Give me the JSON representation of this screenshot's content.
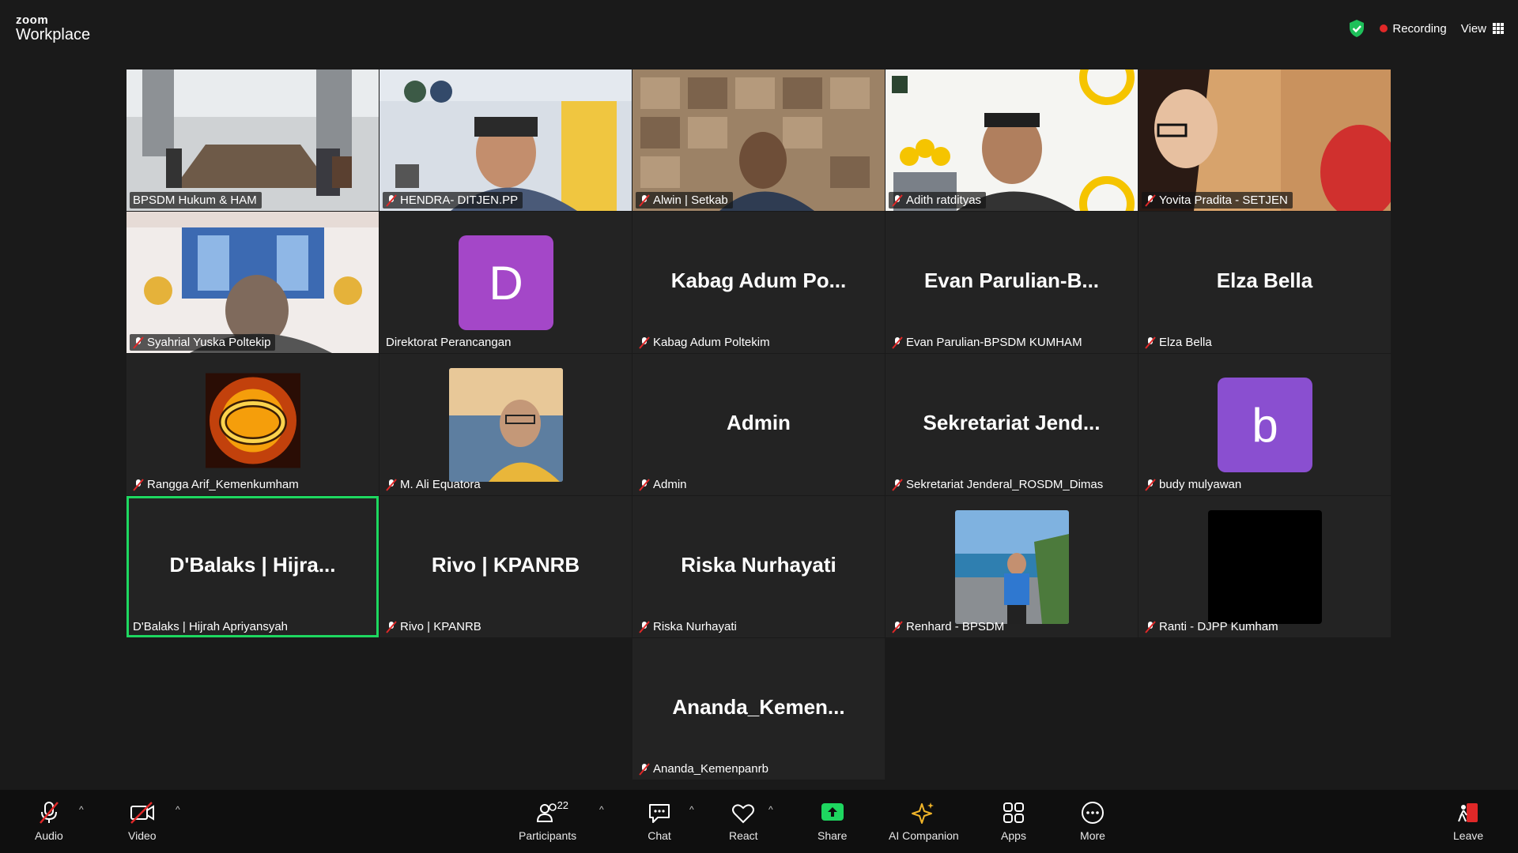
{
  "app": {
    "brand_small": "zoom",
    "brand_large": "Workplace"
  },
  "top": {
    "recording_label": "Recording",
    "view_label": "View"
  },
  "colors": {
    "active_border": "#1ed760",
    "avatar_purple": "#a447c8",
    "recording_dot": "#e02828",
    "share_green": "#1ed760"
  },
  "tiles": [
    {
      "name": "BPSDM Hukum & HAM",
      "muted": false,
      "kind": "video"
    },
    {
      "name": "HENDRA- DITJEN.PP",
      "muted": true,
      "kind": "video"
    },
    {
      "name": "Alwin | Setkab",
      "muted": true,
      "kind": "video"
    },
    {
      "name": "Adith ratdityas",
      "muted": true,
      "kind": "video"
    },
    {
      "name": "Yovita Pradita - SETJEN",
      "muted": true,
      "kind": "video"
    },
    {
      "name": "Syahrial Yuska Poltekip",
      "muted": true,
      "kind": "video"
    },
    {
      "name": "Direktorat Perancangan",
      "muted": false,
      "kind": "avatar",
      "avatar": "D"
    },
    {
      "name": "Kabag Adum Poltekim",
      "muted": true,
      "kind": "text",
      "big": "Kabag  Adum  Po..."
    },
    {
      "name": "Evan Parulian-BPSDM KUMHAM",
      "muted": true,
      "kind": "text",
      "big": "Evan  Parulian-B..."
    },
    {
      "name": "Elza Bella",
      "muted": true,
      "kind": "text",
      "big": "Elza Bella"
    },
    {
      "name": "Rangga Arif_Kemenkumham",
      "muted": true,
      "kind": "photo"
    },
    {
      "name": "M. Ali Equatora",
      "muted": true,
      "kind": "photo"
    },
    {
      "name": "Admin",
      "muted": true,
      "kind": "text",
      "big": "Admin"
    },
    {
      "name": "Sekretariat Jenderal_ROSDM_Dimas",
      "muted": true,
      "kind": "text",
      "big": "Sekretariat  Jend..."
    },
    {
      "name": "budy mulyawan",
      "muted": true,
      "kind": "avatar",
      "avatar": "b"
    },
    {
      "name": "D'Balaks | Hijrah Apriyansyah",
      "muted": false,
      "kind": "text",
      "big": "D'Balaks | Hijra...",
      "active": true
    },
    {
      "name": "Rivo | KPANRB",
      "muted": true,
      "kind": "text",
      "big": "Rivo | KPANRB"
    },
    {
      "name": "Riska Nurhayati",
      "muted": true,
      "kind": "text",
      "big": "Riska Nurhayati"
    },
    {
      "name": "Renhard - BPSDM",
      "muted": true,
      "kind": "photo"
    },
    {
      "name": "Ranti - DJPP Kumham",
      "muted": true,
      "kind": "photo"
    },
    {
      "name": "Ananda_Kemenpanrb",
      "muted": true,
      "kind": "text",
      "big": "Ananda_Kemen..."
    }
  ],
  "toolbar": {
    "audio": "Audio",
    "video": "Video",
    "participants": "Participants",
    "participants_count": "22",
    "chat": "Chat",
    "react": "React",
    "share": "Share",
    "ai": "AI Companion",
    "apps": "Apps",
    "more": "More",
    "leave": "Leave"
  }
}
